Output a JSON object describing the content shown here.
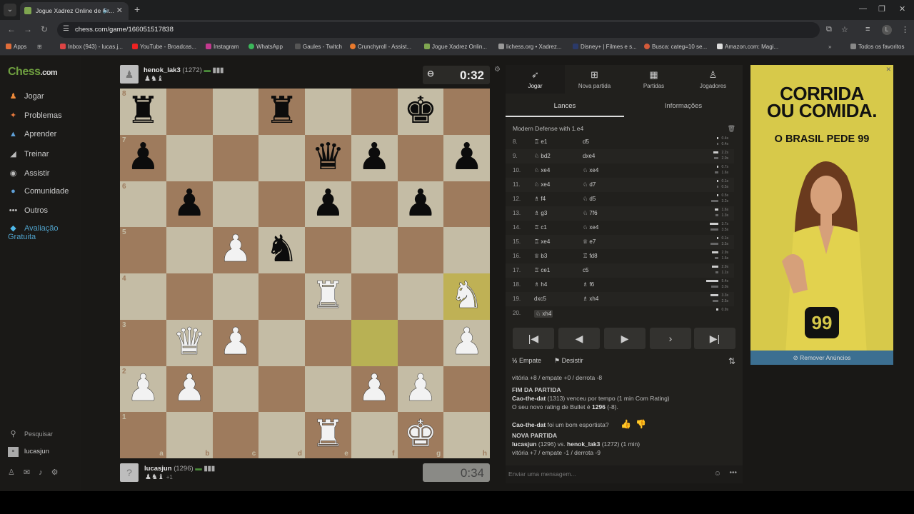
{
  "browser": {
    "tab_title": "Jogue Xadrez Online de Gr...",
    "url": "chess.com/game/166051517838",
    "bookmarks": [
      "Apps",
      "Inbox (943) - lucas.j...",
      "YouTube - Broadcas...",
      "Instagram",
      "WhatsApp",
      "Gaules - Twitch",
      "Crunchyroll - Assist...",
      "Jogue Xadrez Onlin...",
      "lichess.org • Xadrez...",
      "Disney+ | Filmes e s...",
      "Busca: categ=10 se...",
      "Amazon.com: Magi..."
    ],
    "all_bookmarks": "Todos os favoritos",
    "profile_initial": "L"
  },
  "sidebar": {
    "logo_prefix": "Chess",
    "logo_suffix": ".com",
    "items": [
      "Jogar",
      "Problemas",
      "Aprender",
      "Treinar",
      "Assistir",
      "Comunidade",
      "Outros"
    ],
    "premium": "Avaliação Gratuita",
    "search": "Pesquisar",
    "user": "lucasjun"
  },
  "top_player": {
    "name": "henok_lak3",
    "rating": "(1272)",
    "captured": "♟♞♝",
    "clock": "0:32"
  },
  "bottom_player": {
    "name": "lucasjun",
    "rating": "(1296)",
    "captured": "♟♞♝",
    "advantage": "+1",
    "clock": "0:34"
  },
  "board": {
    "files": [
      "a",
      "b",
      "c",
      "d",
      "e",
      "f",
      "g",
      "h"
    ],
    "ranks": [
      "8",
      "7",
      "6",
      "5",
      "4",
      "3",
      "2",
      "1"
    ],
    "pieces": {
      "a8": "bR",
      "d8": "bR",
      "g8": "bK",
      "a7": "bP",
      "e7": "bQ",
      "f7": "bP",
      "h7": "bP",
      "b6": "bP",
      "e6": "bP",
      "g6": "bP",
      "c5": "wP",
      "d5": "bN",
      "e4": "wR",
      "h4": "wN",
      "b3": "wQ",
      "c3": "wP",
      "h3": "wP",
      "a2": "wP",
      "b2": "wP",
      "f2": "wP",
      "g2": "wP",
      "e1": "wR",
      "g1": "wK"
    },
    "highlight": [
      "h4",
      "f3"
    ]
  },
  "right_panel": {
    "tabs": [
      "Jogar",
      "Nova partida",
      "Partidas",
      "Jogadores"
    ],
    "subtabs": [
      "Lances",
      "Informações"
    ],
    "opening": "Modern Defense with 1.e4",
    "moves": [
      {
        "n": "8.",
        "w": "e1",
        "wp": "♖",
        "b": "d5",
        "bp": ""
      },
      {
        "n": "9.",
        "w": "bd2",
        "wp": "♘",
        "b": "dxe4",
        "bp": ""
      },
      {
        "n": "10.",
        "w": "xe4",
        "wp": "♘",
        "b": "xe4",
        "bp": "♘"
      },
      {
        "n": "11.",
        "w": "xe4",
        "wp": "♘",
        "b": "d7",
        "bp": "♘"
      },
      {
        "n": "12.",
        "w": "f4",
        "wp": "♗",
        "b": "d5",
        "bp": "♘"
      },
      {
        "n": "13.",
        "w": "g3",
        "wp": "♗",
        "b": "7f6",
        "bp": "♘"
      },
      {
        "n": "14.",
        "w": "c1",
        "wp": "♖",
        "b": "xe4",
        "bp": "♘"
      },
      {
        "n": "15.",
        "w": "xe4",
        "wp": "♖",
        "b": "e7",
        "bp": "♕"
      },
      {
        "n": "16.",
        "w": "b3",
        "wp": "♕",
        "b": "fd8",
        "bp": "♖"
      },
      {
        "n": "17.",
        "w": "ce1",
        "wp": "♖",
        "b": "c5",
        "bp": ""
      },
      {
        "n": "18.",
        "w": "h4",
        "wp": "♗",
        "b": "f6",
        "bp": "♗"
      },
      {
        "n": "19.",
        "w": "dxc5",
        "wp": "",
        "b": "xh4",
        "bp": "♗"
      },
      {
        "n": "20.",
        "w": "xh4",
        "wp": "♘",
        "b": "",
        "bp": ""
      }
    ],
    "times": [
      [
        "0.4s",
        "0.4s"
      ],
      [
        "2.2s",
        "2.0s"
      ],
      [
        "0.7s",
        "1.6s"
      ],
      [
        "0.1s",
        "0.5s"
      ],
      [
        "0.5s",
        "3.2s"
      ],
      [
        "1.6s",
        "1.3s"
      ],
      [
        "3.7s",
        "3.5s"
      ],
      [
        "0.1s",
        "3.5s"
      ],
      [
        "2.9s",
        "1.6s"
      ],
      [
        "2.9s",
        "1.1s"
      ],
      [
        "5.4s",
        "3.0s"
      ],
      [
        "3.3s",
        "2.5s"
      ],
      [
        "0.9s",
        ""
      ]
    ],
    "draw": "Empate",
    "resign": "Desistir",
    "chat": {
      "l1": "vitória +8 / empate +0 / derrota -8",
      "h1": "FIM DA PARTIDA",
      "l2_name": "Cao-the-dat",
      "l2": "(1313) venceu por tempo (1 min Com Rating)",
      "l3": "O seu novo rating de Bullet é",
      "l3_val": "1296",
      "l3_diff": "(-8).",
      "l4_name": "Cao-the-dat",
      "l4": "foi um bom esportista?",
      "h2": "NOVA PARTIDA",
      "l5_a": "lucasjun",
      "l5_b": "(1296) vs.",
      "l5_c": "henok_lak3",
      "l5_d": "(1272) (1 min)",
      "l6": "vitória +7 / empate -1 / derrota -9"
    },
    "chat_placeholder": "Enviar uma mensagem..."
  },
  "ad": {
    "title_1": "CORRIDA",
    "title_2": "OU COMIDA.",
    "subtitle": "O BRASIL PEDE 99",
    "logo": "99",
    "remove": "Remover Anúncios"
  }
}
